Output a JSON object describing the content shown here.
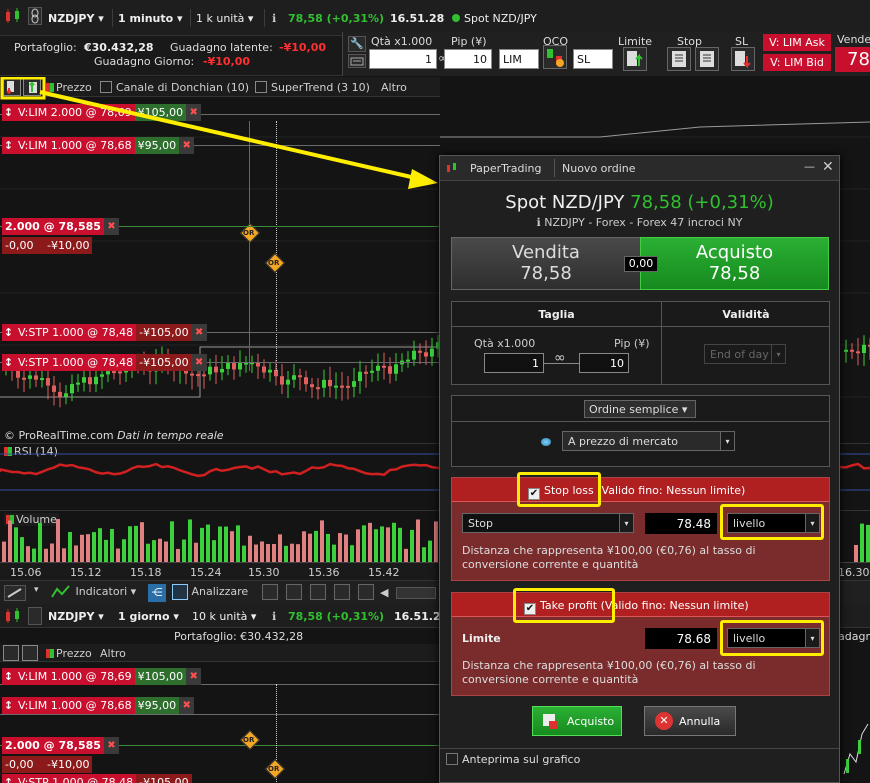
{
  "toolbar_top": {
    "symbol": "NZDJPY",
    "interval": "1 minuto",
    "quantity": "1 k unità",
    "price_change": "78,58 (+0,31%)",
    "time": "16.51.28",
    "instrument": "Spot NZD/JPY"
  },
  "portfolio": {
    "label": "Portafoglio:",
    "value": "€30.432,28",
    "latent_label": "Guadagno latente:",
    "latent_value": "-¥10,00",
    "day_label": "Guadagno Giorno:",
    "day_value": "-¥10,00"
  },
  "order_bar": {
    "qty_label": "Qtà x1.000",
    "qty_value": "1",
    "pip_label": "Pip (¥)",
    "pip_value": "10",
    "oco_label": "OCO",
    "lim_value": "LIM",
    "sl_value": "SL",
    "limite_label": "Limite",
    "stop_label": "Stop",
    "sl_label": "SL",
    "lim_ask": "V: LIM Ask",
    "lim_bid": "V: LIM Bid",
    "vende_label": "Vende",
    "vende_price": "78"
  },
  "chart_top": {
    "toolbar": {
      "prezzo": "Prezzo",
      "donchian": "Canale di Donchian (10)",
      "supertrend": "SuperTrend (3 10)",
      "altro": "Altro"
    },
    "orders": [
      {
        "label": "V:LIM 2.000 @ 78,69",
        "pl": "¥105,00"
      },
      {
        "label": "V:LIM 1.000 @ 78,68",
        "pl": "¥95,00"
      },
      {
        "label": "2.000 @ 78,585",
        "pl": "-0,00  -¥10,00"
      },
      {
        "label": "V:STP 1.000 @ 78,48",
        "pl": "-¥105,00"
      },
      {
        "label": "V:STP 1.000 @ 78,48",
        "pl": "-¥105,00"
      }
    ],
    "pos_pl_left": "-0,00",
    "pos_pl_right": "-¥10,00",
    "or_label": "OR",
    "copyright": "© ProRealTime.com",
    "realtime": "Dati in tempo reale",
    "rsi_label": "RSI (14)",
    "volume_label": "Volume",
    "times": [
      "15.06",
      "15.12",
      "15.18",
      "15.24",
      "15.30",
      "15.36",
      "15.42",
      "16.30"
    ]
  },
  "bottom_toolbar": {
    "indicators": "Indicatori",
    "analyze": "Analizzare"
  },
  "chart_bottom": {
    "symbol": "NZDJPY",
    "interval": "1 giorno",
    "quantity": "10 k unità",
    "price_change": "78,58 (+0,31%)",
    "time": "16.51.2",
    "portfolio": "Portafoglio: €30.432,28",
    "gain_partial": "adagn",
    "prezzo": "Prezzo",
    "altro": "Altro",
    "orders": [
      {
        "label": "V:LIM 1.000 @ 78,69",
        "pl": "¥105,00"
      },
      {
        "label": "V:LIM 1.000 @ 78,68",
        "pl": "¥95,00"
      },
      {
        "label": "2.000 @ 78,585",
        "pl": ""
      },
      {
        "label": "V:STP 1.000 @ 78,48",
        "pl": "-¥105,00"
      }
    ],
    "pos_pl_left": "-0,00",
    "pos_pl_right": "-¥10,00"
  },
  "dialog": {
    "tab_app": "PaperTrading",
    "tab_title": "Nuovo ordine",
    "title_instrument": "Spot NZD/JPY",
    "title_price": "78,58 (+0,31%)",
    "subtitle": "NZDJPY - Forex - Forex 47 incroci NY",
    "sell_label": "Vendita",
    "sell_price": "78,58",
    "spread": "0,00",
    "buy_label": "Acquisto",
    "buy_price": "78,58",
    "size_header": "Taglia",
    "validity_header": "Validità",
    "qty_label": "Qtà x1.000",
    "qty_value": "1",
    "pip_label": "Pip (¥)",
    "pip_value": "10",
    "validity_value": "End of day",
    "order_type": "Ordine semplice",
    "price_mode": "A prezzo di mercato",
    "stop_loss": {
      "title_bold": "Stop loss",
      "title_rest": " (Valido fino: Nessun limite)",
      "type": "Stop",
      "value": "78.48",
      "mode": "livello",
      "note": "Distanza che rappresenta ¥100,00 (€0,76) al tasso di conversione corrente  e quantità"
    },
    "take_profit": {
      "title_bold": "Take profit",
      "title_rest": " (Valido fino: Nessun limite)",
      "type": "Limite",
      "value": "78.68",
      "mode": "livello",
      "note": "Distanza che rappresenta ¥100,00 (€0,76) al tasso di conversione corrente  e quantità"
    },
    "buy_button": "Acquisto",
    "cancel_button": "Annulla",
    "preview": "Anteprima sul grafico"
  },
  "colors": {
    "buy": "#1e9a28",
    "sell": "#3a3a3a",
    "order_red": "#c8102e",
    "highlight": "#ffee00",
    "bull": "#3cd03c",
    "bear": "#e06060"
  }
}
